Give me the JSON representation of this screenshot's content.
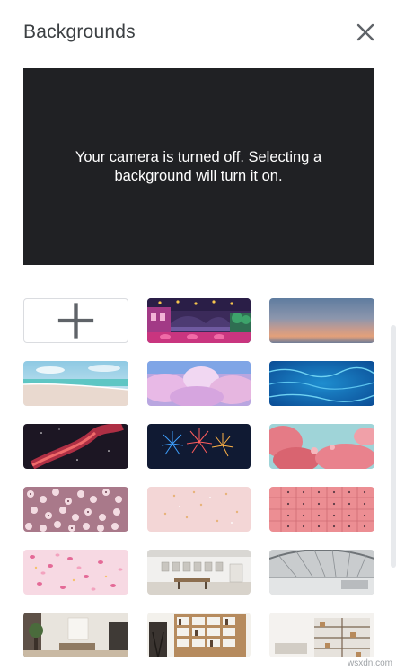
{
  "panel": {
    "title": "Backgrounds",
    "close_icon": "close-icon"
  },
  "preview": {
    "message": "Your camera is turned off. Selecting a background will turn it on."
  },
  "backgrounds": {
    "add_icon": "plus-icon",
    "items": [
      {
        "name": "night-bridge-scene"
      },
      {
        "name": "sunset-gradient"
      },
      {
        "name": "beach"
      },
      {
        "name": "pink-clouds"
      },
      {
        "name": "blue-water"
      },
      {
        "name": "red-nebula"
      },
      {
        "name": "fireworks"
      },
      {
        "name": "pink-blossoms-sky"
      },
      {
        "name": "flower-field"
      },
      {
        "name": "pink-confetti"
      },
      {
        "name": "pink-pattern"
      },
      {
        "name": "petals"
      },
      {
        "name": "white-gallery-room"
      },
      {
        "name": "modern-atrium"
      },
      {
        "name": "living-room"
      },
      {
        "name": "bookshelf-room"
      },
      {
        "name": "white-shelves-room"
      }
    ]
  },
  "footer": {
    "watermark": "wsxdn.com"
  }
}
